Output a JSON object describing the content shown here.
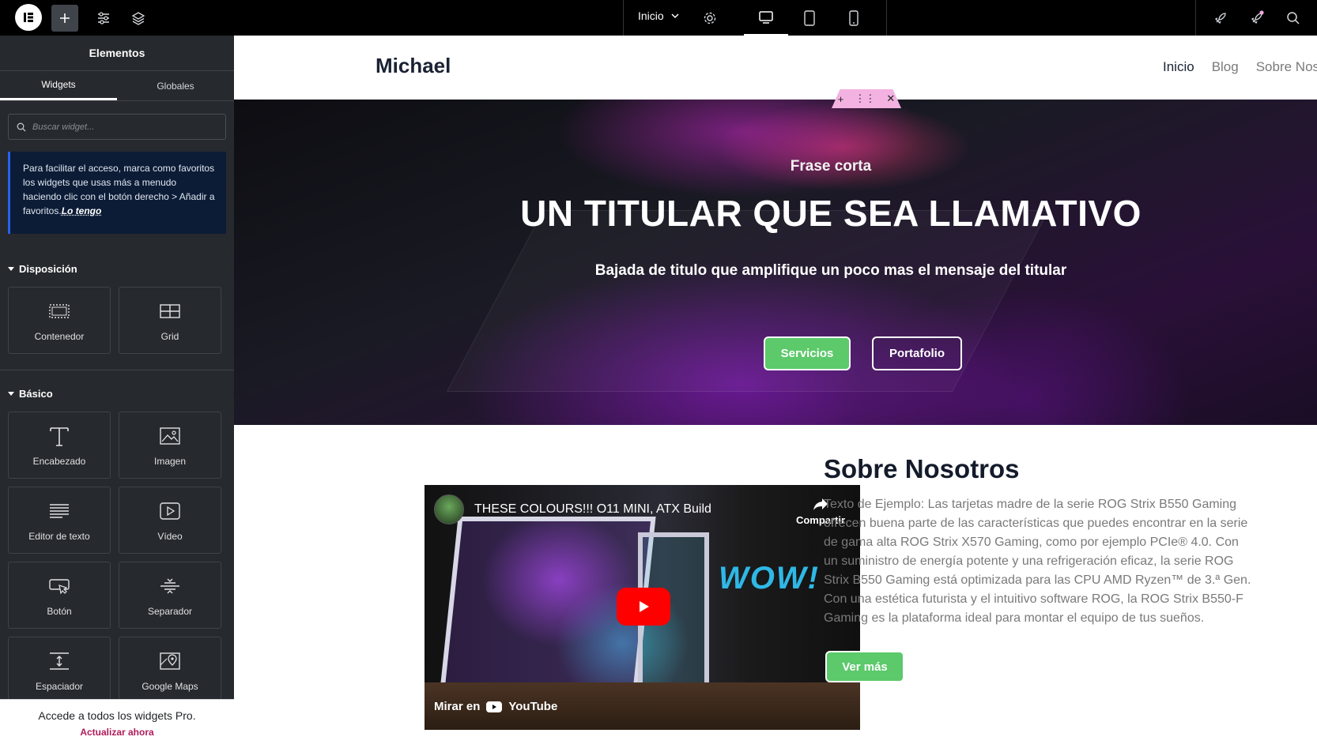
{
  "topbar": {
    "page_name": "Inicio",
    "icons": [
      "elementor-logo-icon",
      "add-icon",
      "site-settings-icon",
      "structure-layers-icon",
      "gear-icon",
      "desktop-icon",
      "tablet-icon",
      "mobile-icon",
      "rocket-icon",
      "notifications-icon",
      "search-icon"
    ]
  },
  "panel": {
    "title": "Elementos",
    "tabs": [
      "Widgets",
      "Globales"
    ],
    "search_placeholder": "Buscar widget...",
    "notice_text": "Para facilitar el acceso, marca como favoritos los widgets que usas más a menudo haciendo clic con el botón derecho > Añadir a favoritos.",
    "notice_link": "Lo tengo",
    "sections": [
      {
        "title": "Disposición",
        "widgets": [
          "Contenedor",
          "Grid"
        ]
      },
      {
        "title": "Básico",
        "widgets": [
          "Encabezado",
          "Imagen",
          "Editor de texto",
          "Vídeo",
          "Botón",
          "Separador",
          "Espaciador",
          "Google Maps"
        ]
      }
    ],
    "pro_text": "Accede a todos los widgets Pro.",
    "pro_link": "Actualizar ahora"
  },
  "site": {
    "brand": "Michael",
    "nav": [
      "Inicio",
      "Blog",
      "Sobre Nos"
    ]
  },
  "hero": {
    "kicker": "Frase corta",
    "title": "UN TITULAR QUE SEA LLAMATIVO",
    "subtitle": "Bajada de titulo que amplifique un poco mas el mensaje del titular",
    "btn_primary": "Servicios",
    "btn_secondary": "Portafolio"
  },
  "video": {
    "title": "THESE COLOURS!!! O11 MINI, ATX Build",
    "share": "Compartir",
    "overlay_text": "WOW!",
    "watch_on": "Mirar en",
    "platform": "YouTube"
  },
  "about": {
    "title": "Sobre Nosotros",
    "text": "Texto de Ejemplo: Las tarjetas madre de la serie ROG Strix B550 Gaming ofrecen buena parte de las características que puedes encontrar en la serie de gama alta ROG Strix X570 Gaming, como por ejemplo PCIe® 4.0. Con un suministro de energía potente y una refrigeración eficaz, la serie ROG Strix B550 Gaming está optimizada para las CPU AMD Ryzen™ de 3.ª Gen. Con una estética futurista y el intuitivo software ROG, la ROG Strix B550-F Gaming es la plataforma ideal para montar el equipo de tus sueños.",
    "button": "Ver más"
  },
  "colors": {
    "accent_green": "#5cc96b",
    "panel_bg": "#26292d",
    "notice_bg": "#0c1c36",
    "link_pink": "#b01b5a"
  }
}
